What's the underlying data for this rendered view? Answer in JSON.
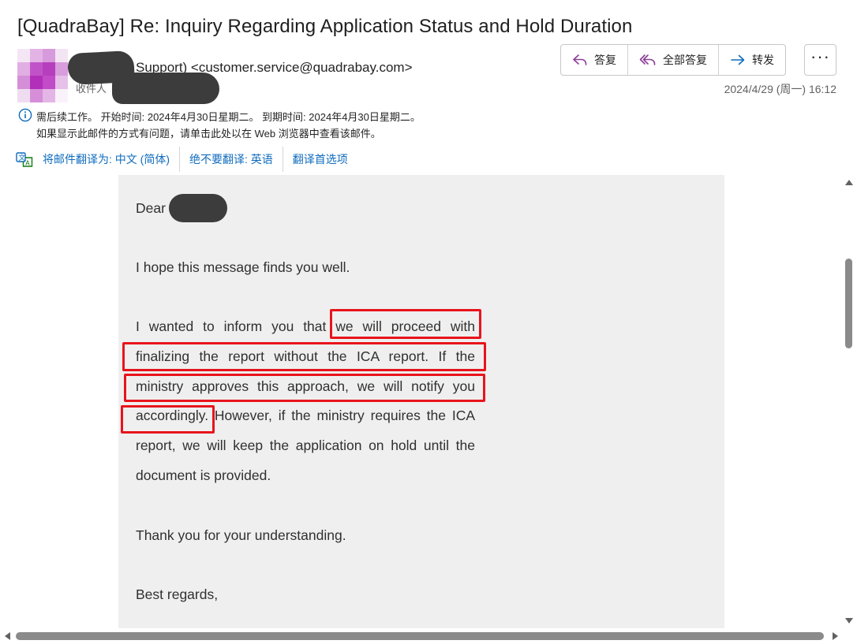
{
  "email": {
    "subject": "[QuadraBay] Re: Inquiry Regarding Application Status and Hold Duration",
    "sender_display": "Support) <customer.service@quadrabay.com>",
    "recipient_label": "收件人",
    "datetime": "2024/4/29 (周一) 16:12"
  },
  "actions": {
    "reply": "答复",
    "reply_all": "全部答复",
    "forward": "转发",
    "more": "···"
  },
  "notice": {
    "followup": "需后续工作。 开始时间: 2024年4月30日星期二。 到期时间: 2024年4月30日星期二。",
    "web_view": "如果显示此邮件的方式有问题，请单击此处以在 Web 浏览器中查看该邮件。"
  },
  "translate": {
    "translate_to": "将邮件翻译为: 中文 (简体)",
    "never_translate": "绝不要翻译: 英语",
    "preferences": "翻译首选项"
  },
  "body": {
    "greeting": "Dear",
    "para1": "I hope this message finds you well.",
    "para2": "I wanted to inform you that we will proceed with finalizing the report without the ICA report. If the ministry approves this approach, we will notify you accordingly. However, if the ministry requires the ICA report, we will keep the application on hold until the document is provided.",
    "para3": "Thank you for your understanding.",
    "para4": "Best regards,"
  },
  "colors": {
    "accent": "#0f6cbd",
    "highlight": "#e8141c",
    "reply_all_icon": "#8b3d98",
    "body_bg": "#efefef"
  },
  "icons": [
    "avatar",
    "reply-icon",
    "reply-all-icon",
    "forward-icon",
    "more-icon",
    "info-icon",
    "translate-icon"
  ]
}
